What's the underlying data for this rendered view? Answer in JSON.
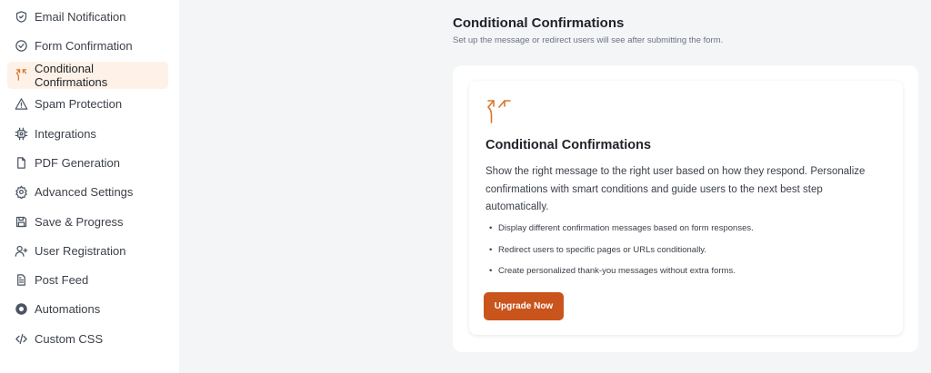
{
  "sidebar": {
    "items": [
      {
        "label": "Email Notification",
        "icon": "shield-check-icon",
        "active": false
      },
      {
        "label": "Form Confirmation",
        "icon": "circle-check-icon",
        "active": false
      },
      {
        "label": "Conditional Confirmations",
        "icon": "branch-split-icon",
        "active": true
      },
      {
        "label": "Spam Protection",
        "icon": "warning-triangle-icon",
        "active": false
      },
      {
        "label": "Integrations",
        "icon": "chip-icon",
        "active": false
      },
      {
        "label": "PDF Generation",
        "icon": "document-icon",
        "active": false
      },
      {
        "label": "Advanced Settings",
        "icon": "gear-icon",
        "active": false
      },
      {
        "label": "Save & Progress",
        "icon": "floppy-disk-icon",
        "active": false
      },
      {
        "label": "User Registration",
        "icon": "user-plus-icon",
        "active": false
      },
      {
        "label": "Post Feed",
        "icon": "post-icon",
        "active": false
      },
      {
        "label": "Automations",
        "icon": "automation-icon",
        "active": false
      },
      {
        "label": "Custom CSS",
        "icon": "code-icon",
        "active": false
      }
    ]
  },
  "header": {
    "title": "Conditional Confirmations",
    "subtitle": "Set up the message or redirect users will see after submitting the form."
  },
  "card": {
    "icon": "branch-split-icon",
    "title": "Conditional Confirmations",
    "description": "Show the right message to the right user based on how they respond. Personalize confirmations with smart conditions and guide users to the next best step automatically.",
    "bullets": [
      "Display different confirmation messages based on form responses.",
      "Redirect users to specific pages or URLs conditionally.",
      "Create personalized thank-you messages without extra forms."
    ],
    "button_label": "Upgrade Now"
  },
  "colors": {
    "accent": "#c9541c",
    "active_bg": "#fdf1e8",
    "icon_orange": "#d9772b"
  }
}
